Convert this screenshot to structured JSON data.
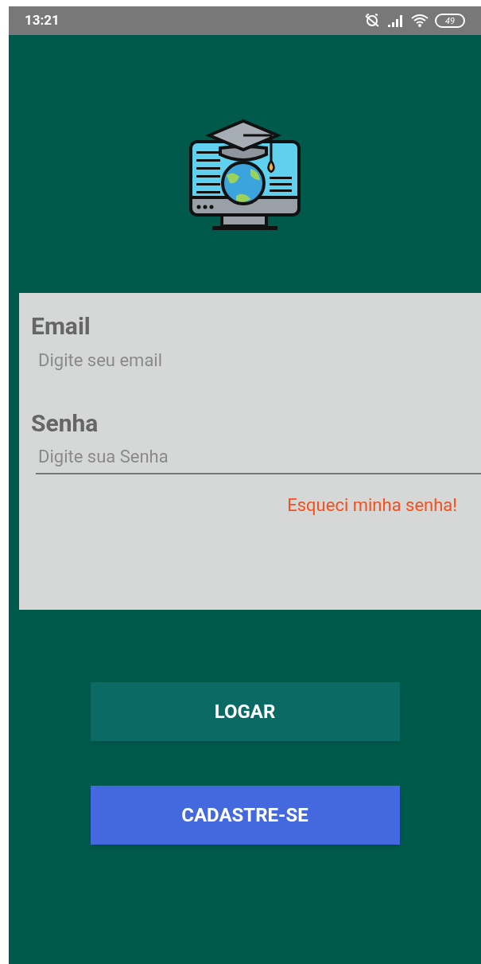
{
  "status_bar": {
    "time": "13:21",
    "battery": "49"
  },
  "form": {
    "fields": [
      {
        "label": "Email",
        "placeholder": "Digite seu email",
        "underlined": false
      },
      {
        "label": "Senha",
        "placeholder": "Digite sua Senha",
        "underlined": true
      }
    ],
    "forgot_link": "Esqueci minha senha!"
  },
  "buttons": [
    {
      "label": "LOGAR",
      "kind": "primary"
    },
    {
      "label": "CADASTRE-SE",
      "kind": "secondary"
    }
  ]
}
